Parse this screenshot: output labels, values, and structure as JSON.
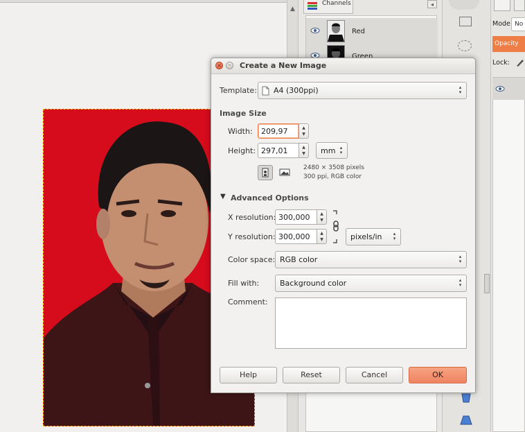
{
  "dock": {
    "channels_tab": "Channels",
    "channels": [
      {
        "label": "Red"
      },
      {
        "label": "Green"
      }
    ]
  },
  "right_dock": {
    "mode_label": "Mode:",
    "mode_value": "No",
    "opacity_label": "Opacity",
    "lock_label": "Lock:"
  },
  "dialog": {
    "title": "Create a New Image",
    "template_label": "Template:",
    "template_value": "A4 (300ppi)",
    "image_size_heading": "Image Size",
    "width_label": "Width:",
    "width_value": "209,97",
    "height_label": "Height:",
    "height_value": "297,01",
    "unit_value": "mm",
    "pixels_info": "2480 × 3508 pixels",
    "ppi_info": "300 ppi, RGB color",
    "advanced_label": "Advanced Options",
    "xres_label": "X resolution:",
    "xres_value": "300,000",
    "yres_label": "Y resolution:",
    "yres_value": "300,000",
    "res_unit_value": "pixels/in",
    "colorspace_label": "Color space:",
    "colorspace_value": "RGB color",
    "fill_label": "Fill with:",
    "fill_value": "Background color",
    "comment_label": "Comment:",
    "comment_value": "",
    "buttons": {
      "help": "Help",
      "reset": "Reset",
      "cancel": "Cancel",
      "ok": "OK"
    }
  },
  "colors": {
    "accent": "#ee7d46",
    "photo_background": "#d60b1c"
  }
}
